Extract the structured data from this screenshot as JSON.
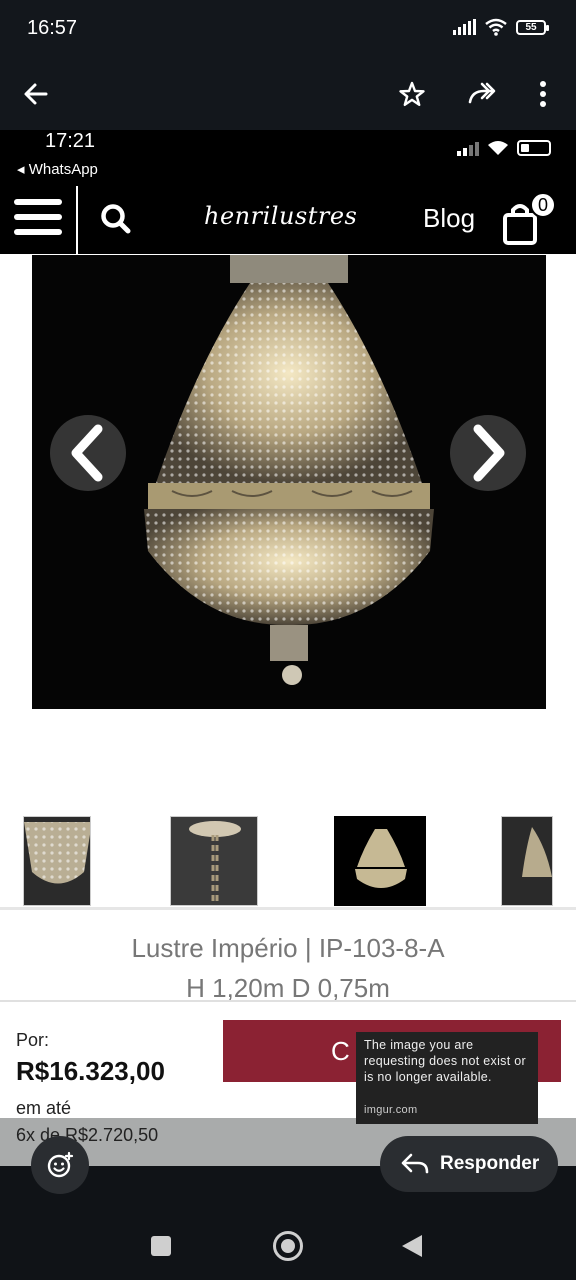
{
  "system_status": {
    "time": "16:57",
    "battery": "55"
  },
  "viewer": {
    "back_icon": "arrow-left-icon",
    "star_icon": "star-icon",
    "forward_icon": "forward-icon",
    "menu_icon": "more-vertical-icon"
  },
  "screenshot": {
    "ios_time": "17:21",
    "back_app": "◂ WhatsApp",
    "header": {
      "logo": "henrilustres",
      "blog": "Blog",
      "cart_count": "0"
    },
    "product": {
      "title": "Lustre Império | IP-103-8-A",
      "dimensions": "H 1,20m D 0,75m",
      "price_label": "Por:",
      "price": "R$16.323,00",
      "installment_label": "em até",
      "installments": "6x de R$2.720,50",
      "buy_button_visible": "C"
    },
    "imgur_error": {
      "message": "The image you are requesting does not exist or is no longer available.",
      "source": "imgur.com"
    }
  },
  "reply": {
    "label": "Responder"
  },
  "colors": {
    "accent_buy": "#8b2233",
    "dark_bg": "#101317"
  }
}
